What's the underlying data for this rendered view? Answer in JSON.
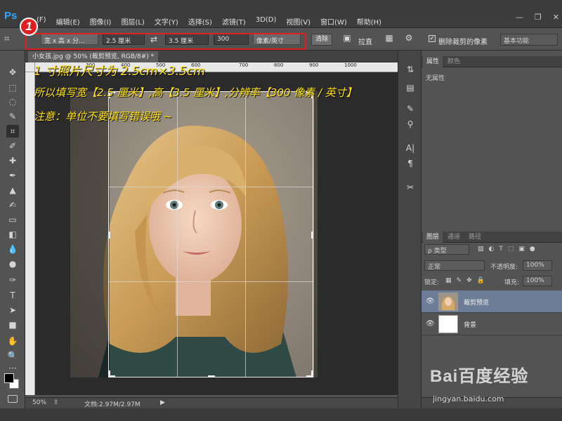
{
  "app": {
    "logo": "Ps"
  },
  "menu": [
    "文件(F)",
    "编辑(E)",
    "图像(I)",
    "图层(L)",
    "文字(Y)",
    "选择(S)",
    "滤镜(T)",
    "3D(D)",
    "视图(V)",
    "窗口(W)",
    "帮助(H)"
  ],
  "menu_visible_first": "(F)",
  "options": {
    "badge_number": "1",
    "ratio_preset": "宽 x 高 x 分...",
    "width_value": "2.5 厘米",
    "height_value": "3.5 厘米",
    "resolution_value": "300",
    "resolution_unit": "像素/英寸",
    "clear_button": "清除",
    "straighten_label": "拉直",
    "delete_cropped_label": "删除裁剪的像素",
    "workspace": "基本功能"
  },
  "document": {
    "tab_title": "小女孩.jpg @ 50% (裁剪预览, RGB/8#) *",
    "ruler_ticks": [
      "300",
      "400",
      "500",
      "600",
      "700",
      "800",
      "900",
      "1000"
    ],
    "zoom": "50%",
    "doc_size": "文档:2.97M/2.97M"
  },
  "annotations": [
    "1 寸照片尺寸为 2.5cm×3.5cm",
    "所以填写宽【2.5 厘米】,高【3.5 厘米】,分辨率【300 像素 / 英寸】",
    "注意：单位不要填写错误哦 ~"
  ],
  "properties_panel": {
    "tabs": [
      "属性",
      "颜色"
    ],
    "empty_text": "无属性"
  },
  "layers_panel": {
    "tabs": [
      "图层",
      "通道",
      "路径"
    ],
    "filter_kind": "ρ 类型",
    "blend_mode": "正常",
    "opacity_label": "不透明度:",
    "opacity_value": "100%",
    "lock_label": "锁定:",
    "fill_label": "填充:",
    "fill_value": "100%",
    "layers": [
      {
        "name": "裁剪预览",
        "selected": true
      },
      {
        "name": "背景",
        "selected": false
      }
    ]
  },
  "watermark": {
    "brand": "Bai百度经验",
    "url": "jingyan.baidu.com"
  },
  "colors": {
    "highlight": "#e02020",
    "annotation": "#ffe313",
    "ps_blue": "#31a8ff",
    "selected_layer": "#6d7d98"
  }
}
